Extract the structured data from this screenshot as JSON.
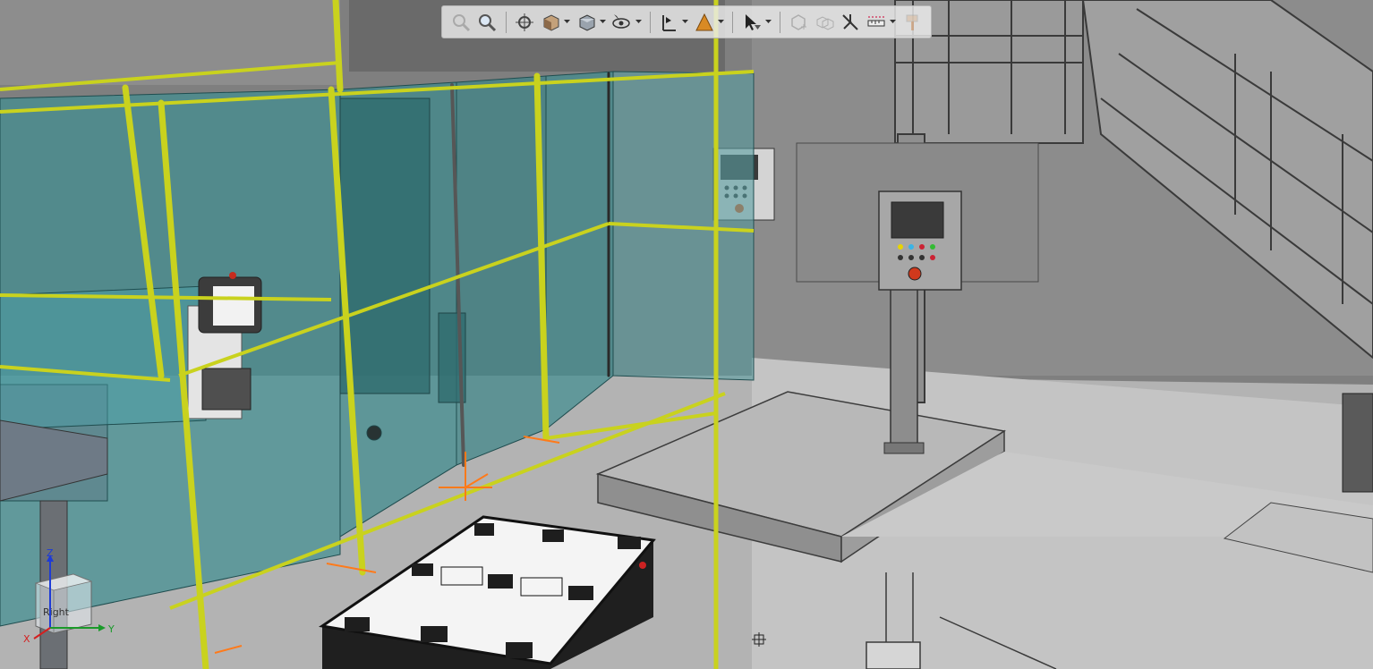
{
  "toolbar": {
    "items": [
      {
        "name": "zoom-fit-icon",
        "disabled": true
      },
      {
        "name": "zoom-area-icon",
        "disabled": false
      },
      {
        "name": "view-center-icon",
        "disabled": false
      },
      {
        "name": "view-orientation-icon",
        "disabled": false,
        "dropdown": true
      },
      {
        "name": "display-style-icon",
        "disabled": false,
        "dropdown": true
      },
      {
        "name": "hide-show-icon",
        "disabled": false,
        "dropdown": true
      },
      {
        "name": "section-view-icon",
        "disabled": false,
        "dropdown": true
      },
      {
        "name": "appearance-icon",
        "disabled": false,
        "dropdown": true
      },
      {
        "name": "selection-filter-icon",
        "disabled": false,
        "dropdown": true
      },
      {
        "name": "insert-component-icon",
        "disabled": true
      },
      {
        "name": "assembly-icon",
        "disabled": true
      },
      {
        "name": "mate-icon",
        "disabled": false
      },
      {
        "name": "measure-icon",
        "disabled": false,
        "dropdown": true
      },
      {
        "name": "paint-icon",
        "disabled": true
      }
    ]
  },
  "view_cube": {
    "face_label": "Right"
  },
  "triad": {
    "x_label": "X",
    "y_label": "Y",
    "z_label": "Z"
  },
  "colors": {
    "fence_yellow": "#c9d21e",
    "glass_teal": "#3e8f92",
    "floor_grey": "#b9b9b9",
    "platform_grey": "#a6a6a6",
    "background_wall": "#7d7d7d",
    "robot_orange": "#ff7a1a"
  }
}
